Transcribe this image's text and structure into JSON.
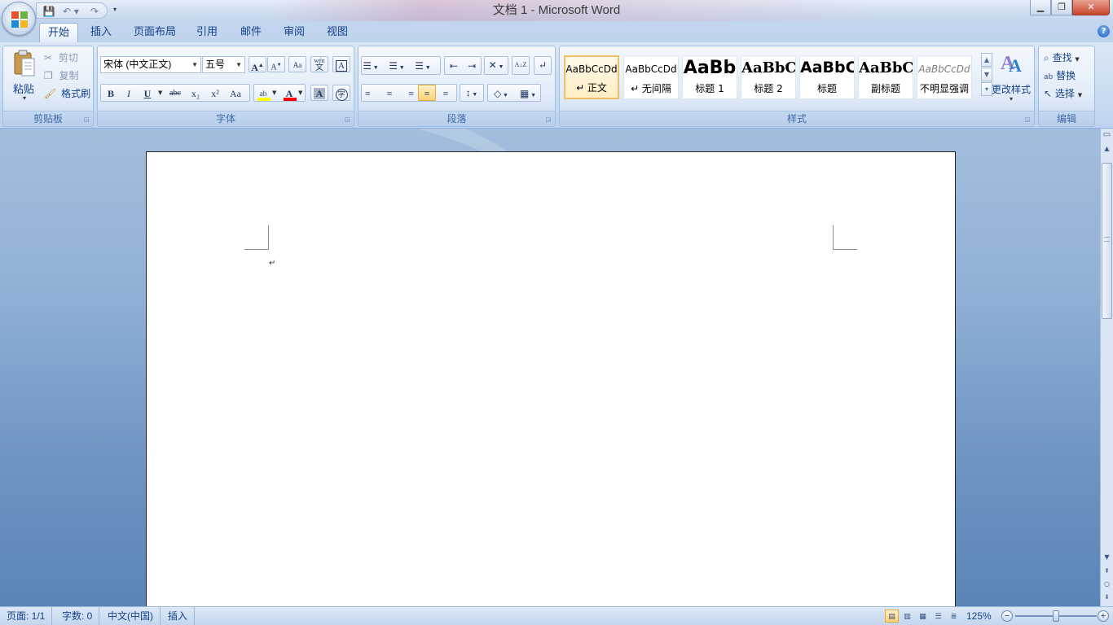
{
  "window": {
    "title": "文档 1 - Microsoft Word",
    "controls": {
      "minimize": "▁",
      "maximize": "❐",
      "close": "✕"
    }
  },
  "quick_access": {
    "save": "💾",
    "undo": "↶ ▾",
    "redo": "↷",
    "customize": "▾"
  },
  "tabs": [
    {
      "label": "开始",
      "active": true
    },
    {
      "label": "插入"
    },
    {
      "label": "页面布局"
    },
    {
      "label": "引用"
    },
    {
      "label": "邮件"
    },
    {
      "label": "审阅"
    },
    {
      "label": "视图"
    }
  ],
  "help": "?",
  "clipboard": {
    "group_label": "剪贴板",
    "paste": "粘贴",
    "paste_arrow": "▾",
    "cut": "剪切",
    "copy": "复制",
    "format_painter": "格式刷"
  },
  "font": {
    "group_label": "字体",
    "font_name": "宋体 (中文正文)",
    "font_size": "五号",
    "grow": "A",
    "shrink": "A",
    "clear_format": "Aa",
    "phonetic": "wén",
    "phonetic_sub": "文",
    "char_border": "A",
    "bold": "B",
    "italic": "I",
    "underline": "U",
    "strikethrough": "abc",
    "subscript": "x₂",
    "superscript": "x²",
    "change_case": "Aa",
    "highlight": "ab",
    "font_color": "A",
    "char_shading": "A",
    "enclose": "字",
    "highlight_color": "#ffff00",
    "font_color_value": "#ff0000"
  },
  "paragraph": {
    "group_label": "段落",
    "bullets": "☰",
    "numbering": "☰",
    "multilevel": "☰",
    "decrease_indent": "⇤",
    "increase_indent": "⇥",
    "chinese_layout": "✕",
    "sort": "A↓Z",
    "show_marks": "↵",
    "align_left": "≡",
    "center": "≡",
    "align_right": "≡",
    "justify": "≡",
    "distributed": "≡",
    "line_spacing": "↕",
    "shading": "◇",
    "borders": "▦"
  },
  "styles": {
    "group_label": "样式",
    "items": [
      {
        "sample": "AaBbCcDd",
        "name": "↵ 正文",
        "selected": true
      },
      {
        "sample": "AaBbCcDd",
        "name": "↵ 无间隔"
      },
      {
        "sample": "AaBb",
        "name": "标题 1"
      },
      {
        "sample": "AaBbC",
        "name": "标题 2"
      },
      {
        "sample": "AaBbC",
        "name": "标题"
      },
      {
        "sample": "AaBbC",
        "name": "副标题"
      },
      {
        "sample": "AaBbCcDd",
        "name": "不明显强调"
      }
    ],
    "change_styles": "更改样式",
    "change_styles_arrow": "▾"
  },
  "editing": {
    "group_label": "编辑",
    "find": "查找",
    "replace": "替换",
    "select": "选择"
  },
  "document": {
    "paragraph_mark": "↵"
  },
  "status": {
    "page": "页面: 1/1",
    "words": "字数: 0",
    "language": "中文(中国)",
    "mode": "插入",
    "zoom": "125%",
    "zoom_out": "−",
    "zoom_in": "+",
    "zoom_percent": 125
  },
  "colors": {
    "accent": "#15428b",
    "ribbon_border": "#8db2e3",
    "selected_style_border": "#f0c06a",
    "close_button": "#c8452b"
  }
}
